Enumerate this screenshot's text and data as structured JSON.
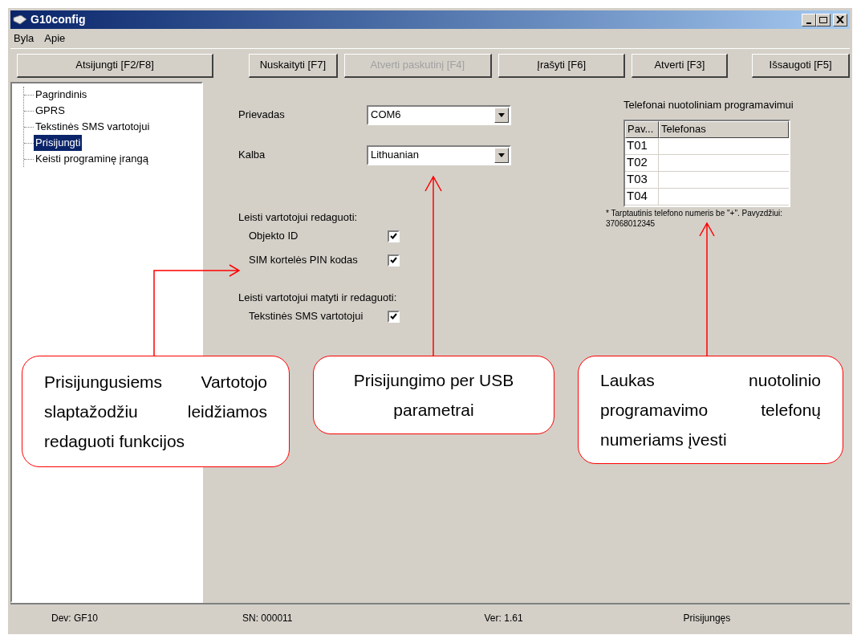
{
  "window": {
    "title": "G10config"
  },
  "menu": [
    "Byla",
    "Apie"
  ],
  "toolbar": [
    {
      "label": "Atsijungti [F2/F8]",
      "disabled": false
    },
    {
      "label": "Nuskaityti [F7]",
      "disabled": false
    },
    {
      "label": "Atverti paskutinį [F4]",
      "disabled": true
    },
    {
      "label": "Įrašyti [F6]",
      "disabled": false
    },
    {
      "label": "Atverti [F3]",
      "disabled": false
    },
    {
      "label": "Išsaugoti [F5]",
      "disabled": false
    }
  ],
  "tree": [
    {
      "label": "Pagrindinis",
      "selected": false
    },
    {
      "label": "GPRS",
      "selected": false
    },
    {
      "label": "Tekstinės SMS vartotojui",
      "selected": false
    },
    {
      "label": "Prisijungti",
      "selected": true
    },
    {
      "label": "Keisti programinę įrangą",
      "selected": false
    }
  ],
  "form": {
    "port": {
      "label": "Prievadas",
      "value": "COM6"
    },
    "language": {
      "label": "Kalba",
      "value": "Lithuanian"
    },
    "sections": [
      {
        "title": "Leisti vartotojui redaguoti:",
        "options": [
          {
            "label": "Objekto ID",
            "checked": true
          },
          {
            "label": "SIM kortelės PIN kodas",
            "checked": true
          }
        ]
      },
      {
        "title": "Leisti vartotojui matyti ir redaguoti:",
        "options": [
          {
            "label": "Tekstinės SMS vartotojui",
            "checked": true
          }
        ]
      }
    ]
  },
  "phones": {
    "title": "Telefonai nuotoliniam programavimui",
    "columns": [
      "Pav...",
      "Telefonas"
    ],
    "rows": [
      "T01",
      "T02",
      "T03",
      "T04"
    ],
    "note": "* Tarptautinis telefono numeris be \"+\". Pavyzdžiui: 37068012345"
  },
  "status_bar": [
    "Dev: GF10",
    "SN: 000011",
    "Ver: 1.61",
    "Prisijungęs"
  ],
  "callouts": [
    {
      "text": "Prisijungusiems Vartotojo slaptažodžiu leidžiamos redaguoti funkcijos"
    },
    {
      "text": "Prisijungimo per USB parametrai"
    },
    {
      "text": "Laukas nuotolinio programavimo telefonų numeriams įvesti"
    }
  ]
}
